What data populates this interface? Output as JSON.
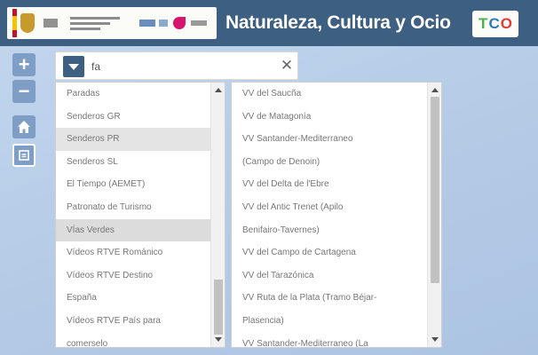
{
  "app": {
    "title": "Naturaleza, Cultura y Ocio",
    "brand_logo": [
      "T",
      "C",
      "O"
    ],
    "accent_color": "#3d5f82"
  },
  "controls": {
    "zoom_in": "+",
    "zoom_out": "−",
    "icons": [
      "plus-icon",
      "minus-icon",
      "home-icon",
      "layers-icon"
    ]
  },
  "search": {
    "value": "fa",
    "clear": "✕"
  },
  "categories": {
    "items": [
      "Paradas",
      "Senderos GR",
      "Senderos PR",
      "Senderos SL",
      "El Tiempo (AEMET)",
      "Patronato de Turismo",
      "VÍas Verdes",
      "Vídeos RTVE Románico",
      "Vídeos RTVE Destino",
      "España",
      "Vídeos RTVE País para",
      "comerselo"
    ],
    "selected_index": 2,
    "active_index": 6
  },
  "results": {
    "items": [
      "VV del Saucña",
      "VV de Matagonía",
      "VV Santander-Mediterraneo",
      "(Campo de Denoin)",
      "VV del Delta de l'Ebre",
      "VV del Antic Trenet (Apilo",
      "Benifairo-Tavernes)",
      "VV del Campo de Cartagena",
      "VV del Tarazónica",
      "VV Ruta de la Plata (Tramo Béjar-",
      "Plasencia)",
      "VV Santander-Mediterraneo (La"
    ]
  }
}
